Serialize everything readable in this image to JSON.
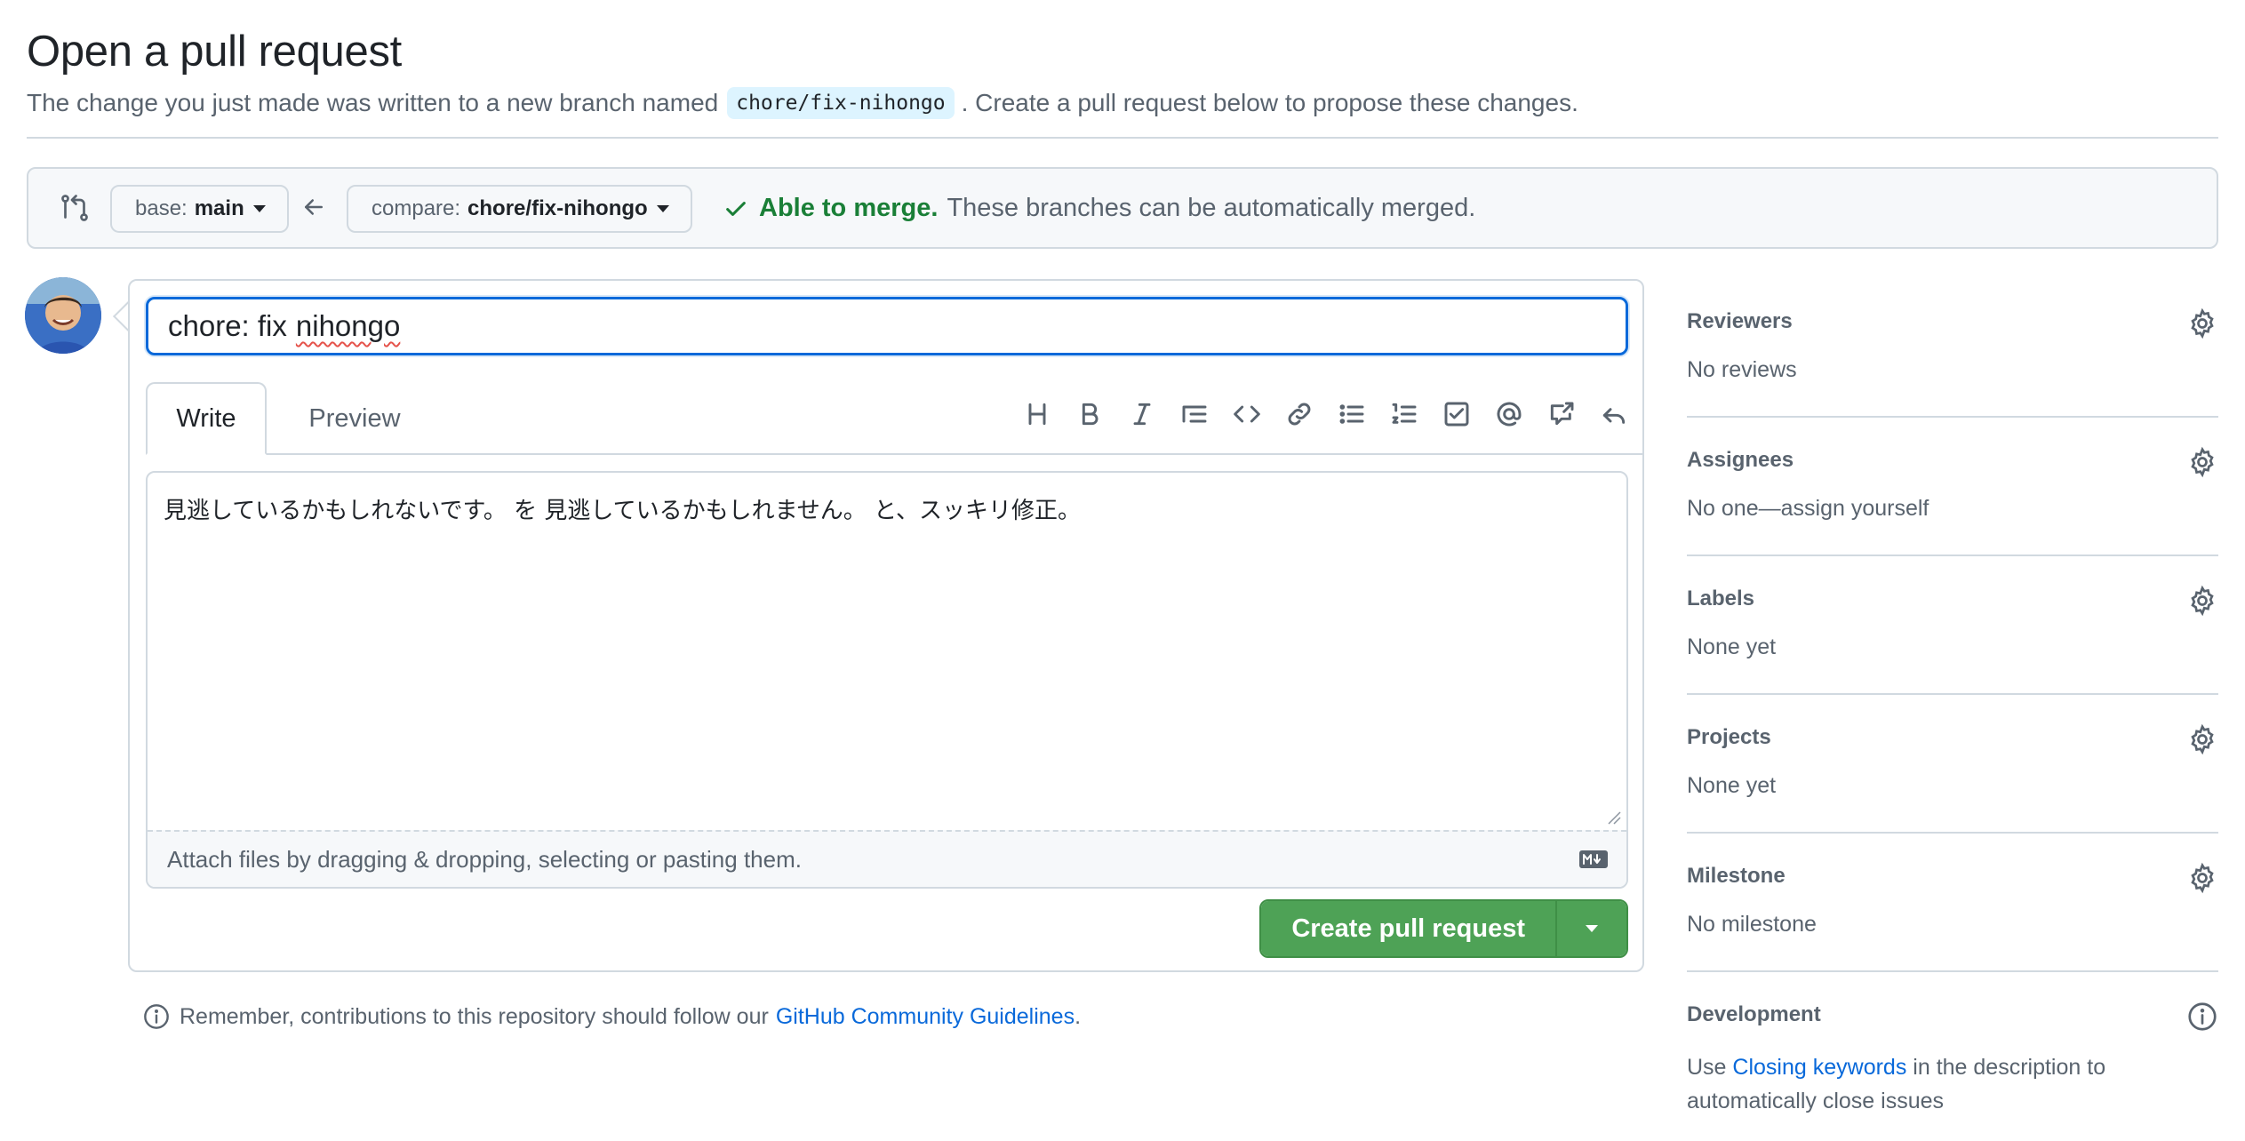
{
  "header": {
    "title": "Open a pull request",
    "subtitle_before": "The change you just made was written to a new branch named",
    "branch_code": "chore/fix-nihongo",
    "subtitle_after": ". Create a pull request below to propose these changes."
  },
  "range": {
    "base_prefix": "base:",
    "base_value": "main",
    "compare_prefix": "compare:",
    "compare_value": "chore/fix-nihongo",
    "merge_ok": "Able to merge.",
    "merge_msg": "These branches can be automatically merged."
  },
  "composer": {
    "title_value_a": "chore: fix",
    "title_value_b": "nihongo",
    "tabs": [
      {
        "label": "Write"
      },
      {
        "label": "Preview"
      }
    ],
    "body_text": "見逃しているかもしれないです。 を 見逃しているかもしれません。 と、スッキリ修正。",
    "attach_text": "Attach files by dragging & dropping, selecting or pasting them.",
    "create_label": "Create pull request",
    "toolbar_icons": [
      "heading-icon",
      "bold-icon",
      "italic-icon",
      "quote-icon",
      "code-icon",
      "link-icon",
      "bulleted-list-icon",
      "numbered-list-icon",
      "task-list-icon",
      "mention-icon",
      "cross-reference-icon",
      "reply-icon"
    ]
  },
  "footer": {
    "remember_text": "Remember, contributions to this repository should follow our",
    "link_text": "GitHub Community Guidelines",
    "period": "."
  },
  "sidebar": {
    "sections": [
      {
        "title": "Reviewers",
        "value": "No reviews"
      },
      {
        "title": "Assignees",
        "value": "No one—assign yourself"
      },
      {
        "title": "Labels",
        "value": "None yet"
      },
      {
        "title": "Projects",
        "value": "None yet"
      },
      {
        "title": "Milestone",
        "value": "No milestone"
      }
    ],
    "development": {
      "title": "Development",
      "pre": "Use",
      "link": "Closing keywords",
      "post": "in the description to automatically close issues"
    }
  },
  "colors": {
    "accent": "#0969da",
    "success": "#1a7f37",
    "primary_button": "#4ea256"
  }
}
